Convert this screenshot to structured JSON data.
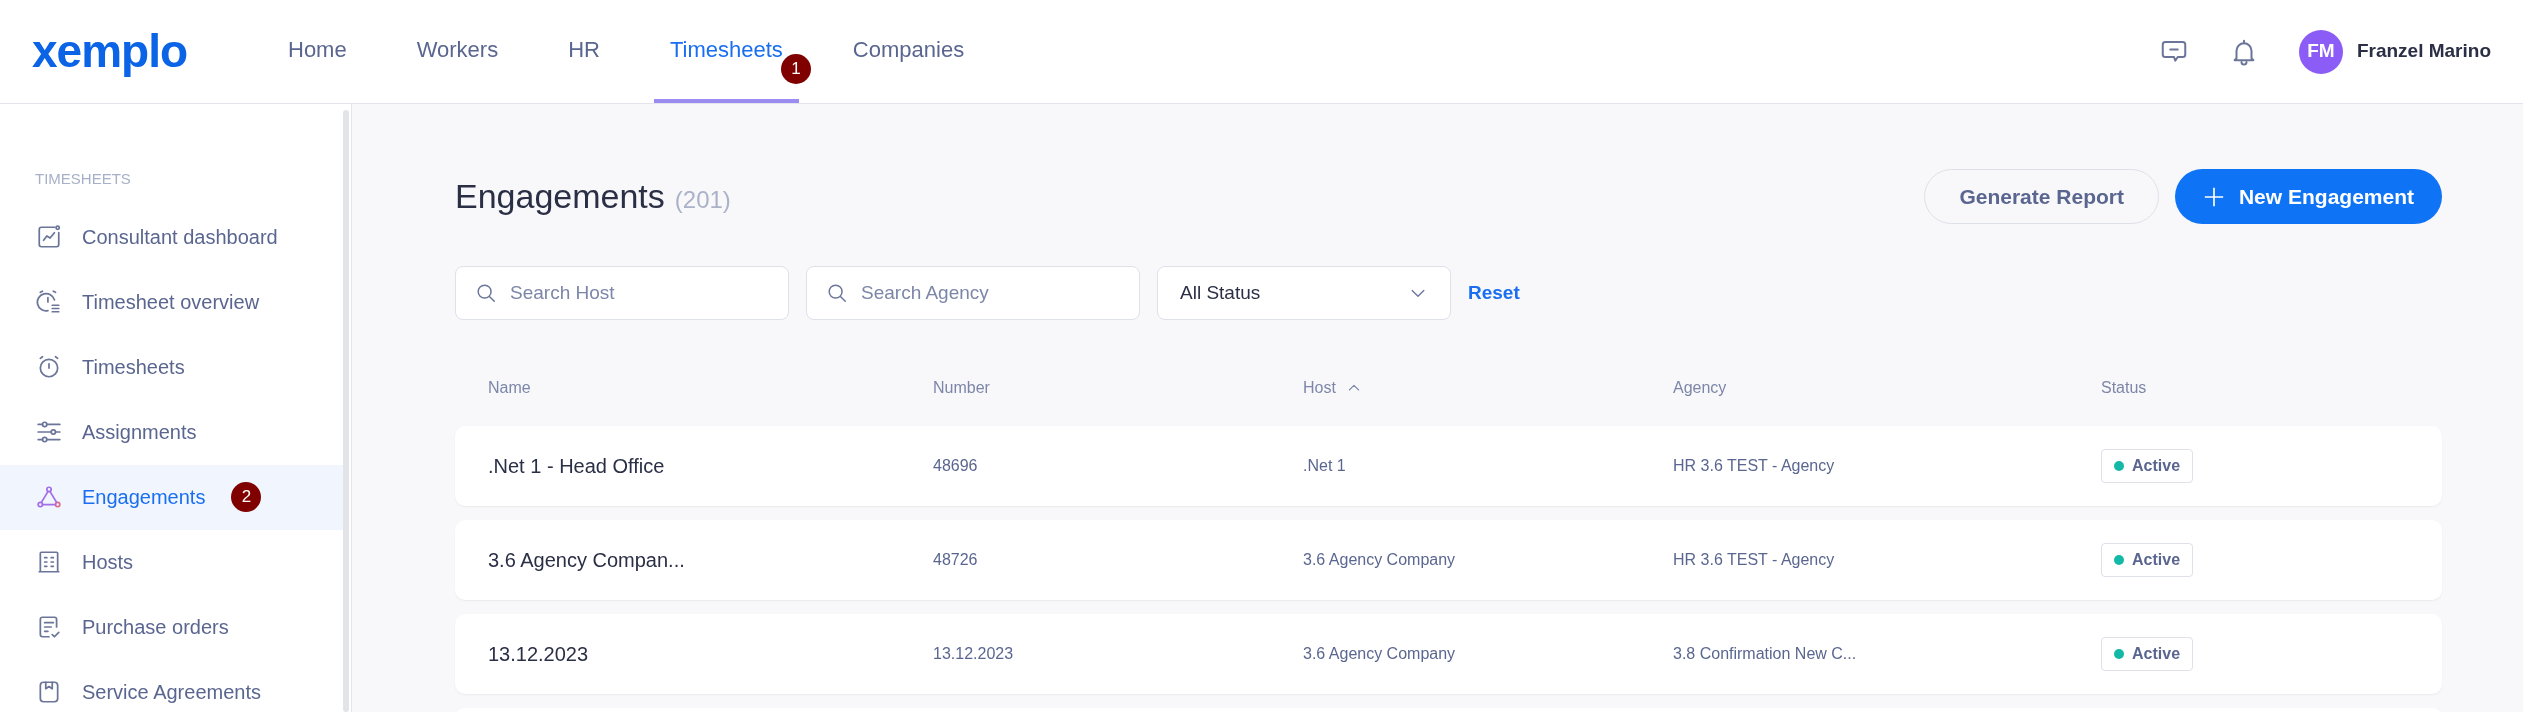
{
  "header": {
    "logo": "xemplo",
    "nav": [
      {
        "label": "Home",
        "selected": false
      },
      {
        "label": "Workers",
        "selected": false
      },
      {
        "label": "HR",
        "selected": false
      },
      {
        "label": "Timesheets",
        "selected": true,
        "badge": "1"
      },
      {
        "label": "Companies",
        "selected": false
      }
    ],
    "user": {
      "initials": "FM",
      "name": "Franzel Marino"
    }
  },
  "sidebar": {
    "section": "TIMESHEETS",
    "items": [
      {
        "label": "Consultant dashboard",
        "kind": "chart",
        "selected": false
      },
      {
        "label": "Timesheet overview",
        "kind": "clocklist",
        "selected": false
      },
      {
        "label": "Timesheets",
        "kind": "clock",
        "selected": false
      },
      {
        "label": "Assignments",
        "kind": "sliders",
        "selected": false
      },
      {
        "label": "Engagements",
        "kind": "triangle",
        "selected": true,
        "badge": "2"
      },
      {
        "label": "Hosts",
        "kind": "building",
        "selected": false
      },
      {
        "label": "Purchase orders",
        "kind": "doc",
        "selected": false
      },
      {
        "label": "Service Agreements",
        "kind": "bookmark",
        "selected": false
      }
    ]
  },
  "page": {
    "title": "Engagements",
    "count": "(201)",
    "buttons": {
      "secondary": "Generate Report",
      "primary": "New Engagement"
    },
    "filters": {
      "host_placeholder": "Search Host",
      "agency_placeholder": "Search Agency",
      "status": "All Status",
      "reset": "Reset"
    },
    "table": {
      "columns": [
        {
          "label": "Name",
          "sorted": false
        },
        {
          "label": "Number",
          "sorted": false
        },
        {
          "label": "Host",
          "sorted": true
        },
        {
          "label": "Agency",
          "sorted": false
        },
        {
          "label": "Status",
          "sorted": false
        }
      ],
      "rows": [
        {
          "name": ".Net 1 - Head Office",
          "number": "48696",
          "host": ".Net 1",
          "agency": "HR 3.6 TEST - Agency",
          "status": "Active",
          "color": "#14b8a6"
        },
        {
          "name": "3.6 Agency Compan...",
          "number": "48726",
          "host": "3.6 Agency Company",
          "agency": "HR 3.6 TEST - Agency",
          "status": "Active",
          "color": "#14b8a6"
        },
        {
          "name": "13.12.2023",
          "number": "13.12.2023",
          "host": "3.6 Agency Company",
          "agency": "3.8 Confirmation New C...",
          "status": "Active",
          "color": "#14b8a6"
        }
      ]
    }
  }
}
